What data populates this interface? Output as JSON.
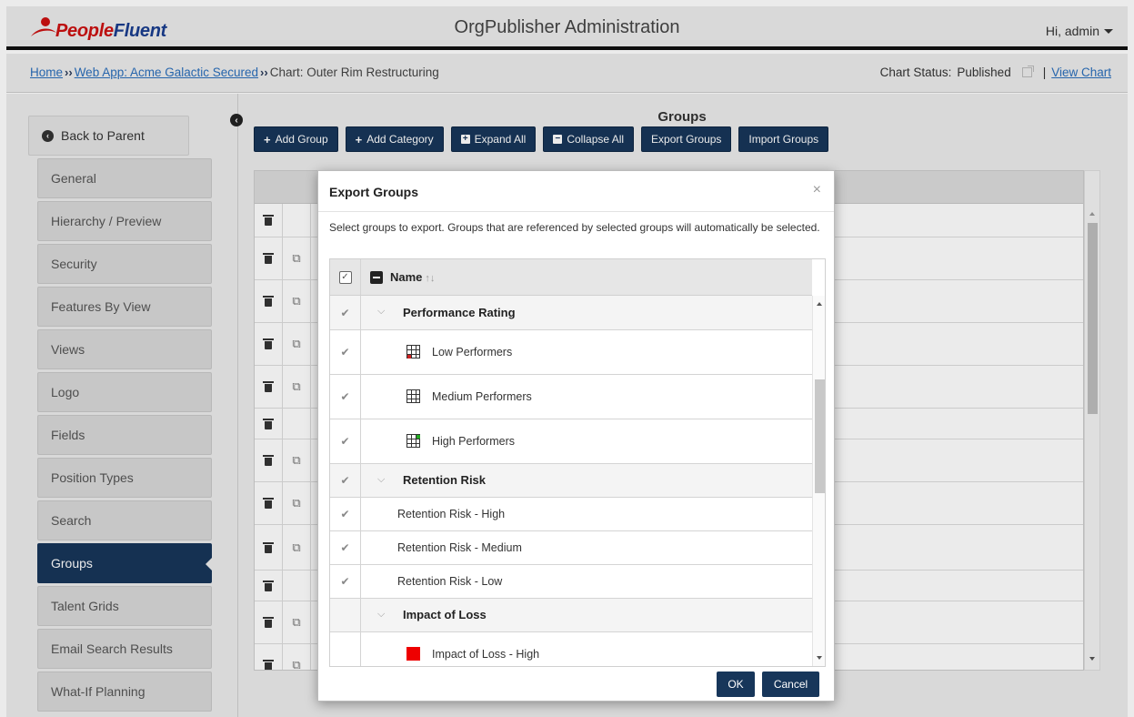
{
  "header": {
    "logo_prefix": "People",
    "logo_suffix": "Fluent",
    "title": "OrgPublisher Administration",
    "user": "Hi, admin"
  },
  "breadcrumb": {
    "home": "Home",
    "web_app": "Web App: Acme Galactic Secured",
    "chart_prefix": "Chart:",
    "chart_name": "Outer Rim Restructuring",
    "status_label": "Chart Status:",
    "status_value": "Published",
    "separator": "|",
    "view_chart": "View Chart"
  },
  "sidebar": {
    "back": "Back to Parent",
    "items": [
      {
        "label": "General"
      },
      {
        "label": "Hierarchy / Preview"
      },
      {
        "label": "Security"
      },
      {
        "label": "Features By View"
      },
      {
        "label": "Views"
      },
      {
        "label": "Logo"
      },
      {
        "label": "Fields"
      },
      {
        "label": "Position Types"
      },
      {
        "label": "Search"
      },
      {
        "label": "Groups",
        "active": true
      },
      {
        "label": "Talent Grids"
      },
      {
        "label": "Email Search Results"
      },
      {
        "label": "What-If Planning"
      }
    ]
  },
  "groups_page": {
    "title": "Groups",
    "toolbar": {
      "add_group": "Add Group",
      "add_category": "Add Category",
      "expand_all": "Expand All",
      "collapse_all": "Collapse All",
      "export_groups": "Export Groups",
      "import_groups": "Import Groups"
    }
  },
  "modal": {
    "title": "Export Groups",
    "close": "×",
    "description": "Select groups to export. Groups that are referenced by selected groups will automatically be selected.",
    "column_name": "Name",
    "sort_glyph": "↑↓",
    "rows": [
      {
        "type": "category",
        "label": "Performance Rating",
        "checked": true
      },
      {
        "type": "item",
        "label": "Low Performers",
        "icon": "grid-icon",
        "checked": true
      },
      {
        "type": "item",
        "label": "Medium Performers",
        "icon": "grid-icon",
        "checked": true
      },
      {
        "type": "item",
        "label": "High Performers",
        "icon": "grid-icon",
        "checked": true
      },
      {
        "type": "category",
        "label": "Retention Risk",
        "checked": true
      },
      {
        "type": "item",
        "label": "Retention Risk - High",
        "checked": true
      },
      {
        "type": "item",
        "label": "Retention Risk - Medium",
        "checked": true
      },
      {
        "type": "item",
        "label": "Retention Risk - Low",
        "checked": true
      },
      {
        "type": "category",
        "label": "Impact of Loss",
        "checked": false
      },
      {
        "type": "item",
        "label": "Impact of Loss - High",
        "icon": "red-square-icon",
        "checked": false
      }
    ],
    "ok": "OK",
    "cancel": "Cancel"
  },
  "colors": {
    "primary_navy": "#17365a",
    "logo_red": "#cc1111",
    "logo_blue": "#1a3d8f",
    "link_blue": "#2a6ebb",
    "impact_high_red": "#ee0000"
  }
}
